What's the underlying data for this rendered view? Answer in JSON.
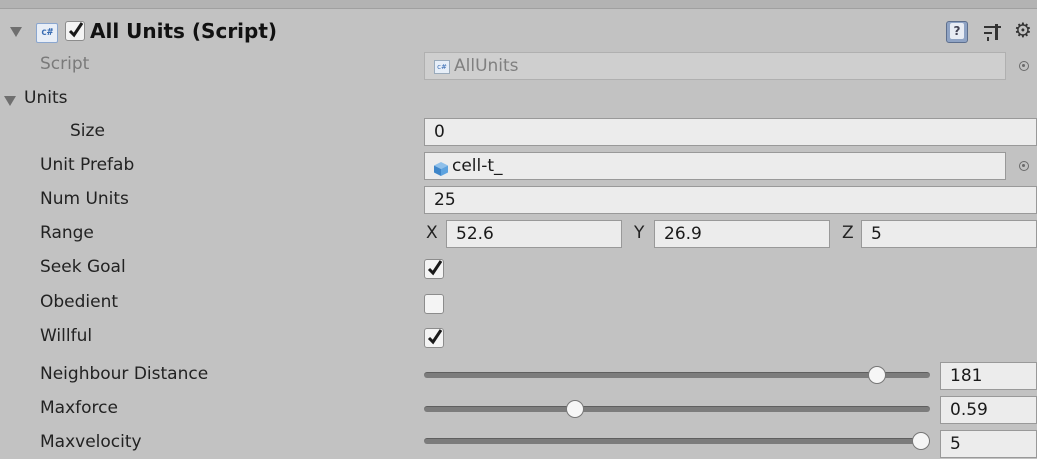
{
  "component": {
    "title": "All Units (Script)",
    "enabled": true,
    "cs_badge": "c#",
    "icons": [
      "foldout-arrow",
      "cs-script-icon",
      "help-icon",
      "preset-icon",
      "gear-icon"
    ]
  },
  "script": {
    "label": "Script",
    "value": "AllUnits"
  },
  "units": {
    "label": "Units",
    "size_label": "Size",
    "size_value": "0"
  },
  "unit_prefab": {
    "label": "Unit Prefab",
    "value": "cell-t_"
  },
  "num_units": {
    "label": "Num Units",
    "value": "25"
  },
  "range": {
    "label": "Range",
    "x_label": "X",
    "x": "52.6",
    "y_label": "Y",
    "y": "26.9",
    "z_label": "Z",
    "z": "5"
  },
  "seek_goal": {
    "label": "Seek Goal",
    "checked": true
  },
  "obedient": {
    "label": "Obedient",
    "checked": false
  },
  "willful": {
    "label": "Willful",
    "checked": true
  },
  "neighbour_distance": {
    "label": "Neighbour Distance",
    "value": "181",
    "fraction": 0.91
  },
  "maxforce": {
    "label": "Maxforce",
    "value": "0.59",
    "fraction": 0.29
  },
  "maxvelocity": {
    "label": "Maxvelocity",
    "value": "5",
    "fraction": 1.0
  }
}
